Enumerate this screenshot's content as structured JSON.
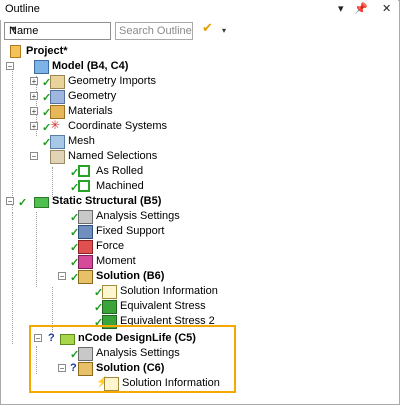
{
  "window": {
    "title": "Outline",
    "controls": [
      "▾",
      "📌",
      "✕"
    ]
  },
  "toolbar": {
    "name_select": "Name",
    "search_placeholder": "Search Outline",
    "filter_icon": "filter-icon",
    "menu_arrow": "▾"
  },
  "tree": {
    "project": "Project*",
    "model": "Model (B4, C4)",
    "geometry_imports": "Geometry Imports",
    "geometry": "Geometry",
    "materials": "Materials",
    "coordinate_systems": "Coordinate Systems",
    "mesh": "Mesh",
    "named_selections": "Named Selections",
    "as_rolled": "As Rolled",
    "machined": "Machined",
    "static_structural": "Static Structural (B5)",
    "analysis_settings_b": "Analysis Settings",
    "fixed_support": "Fixed Support",
    "force": "Force",
    "moment": "Moment",
    "solution_b6": "Solution (B6)",
    "solution_information_b": "Solution Information",
    "equivalent_stress": "Equivalent Stress",
    "equivalent_stress_2": "Equivalent Stress 2",
    "ncode": "nCode DesignLife (C5)",
    "analysis_settings_c": "Analysis Settings",
    "solution_c6": "Solution (C6)",
    "solution_information_c": "Solution Information"
  },
  "colors": {
    "highlight": "#f5a800",
    "check": "#1e9a1e"
  }
}
